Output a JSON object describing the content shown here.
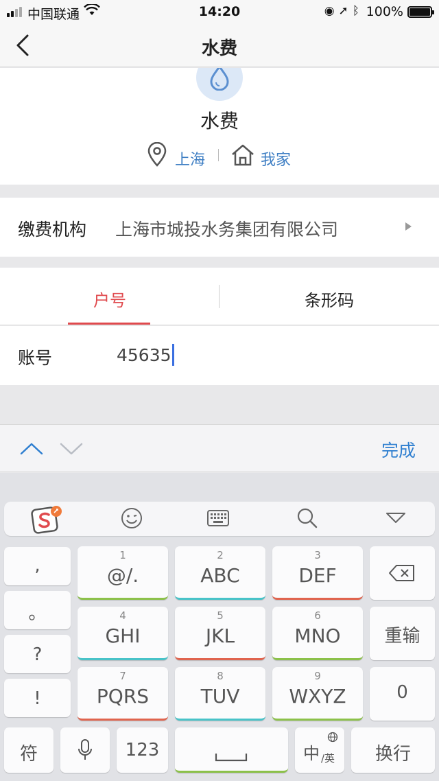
{
  "status_bar": {
    "carrier": "中国联通",
    "time": "14:20",
    "battery": "100%"
  },
  "nav": {
    "title": "水费"
  },
  "header": {
    "title": "水费",
    "city": "上海",
    "home_label": "我家"
  },
  "payee": {
    "label": "缴费机构",
    "value": "上海市城投水务集团有限公司"
  },
  "tabs": {
    "account_no": "户号",
    "barcode": "条形码"
  },
  "account": {
    "label": "账号",
    "value": "45635"
  },
  "accessory": {
    "done": "完成"
  },
  "keyboard": {
    "punct": [
      ",",
      "。",
      "?",
      "!"
    ],
    "keys": [
      {
        "num": "1",
        "letters": "@/."
      },
      {
        "num": "2",
        "letters": "ABC"
      },
      {
        "num": "3",
        "letters": "DEF"
      },
      {
        "num": "4",
        "letters": "GHI"
      },
      {
        "num": "5",
        "letters": "JKL"
      },
      {
        "num": "6",
        "letters": "MNO"
      },
      {
        "num": "7",
        "letters": "PQRS"
      },
      {
        "num": "8",
        "letters": "TUV"
      },
      {
        "num": "9",
        "letters": "WXYZ"
      }
    ],
    "reset": "重输",
    "zero": "0",
    "symbol": "符",
    "numeric": "123",
    "lang_main": "中",
    "lang_sub": "/英",
    "enter": "换行"
  },
  "colors": {
    "accent_red": "#e04a4e",
    "link_blue": "#3f7fc4",
    "done_blue": "#2f7fd0"
  }
}
